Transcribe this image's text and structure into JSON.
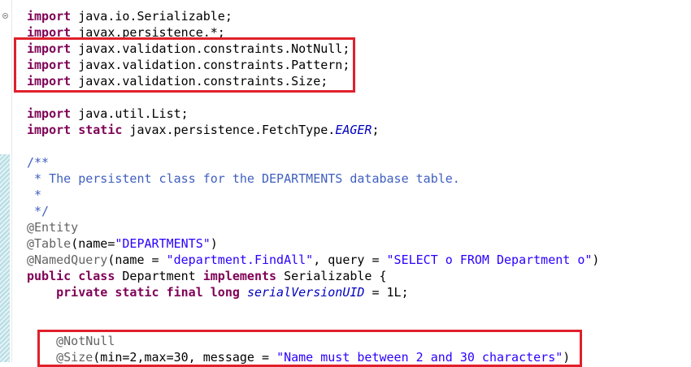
{
  "editor": {
    "language": "Java",
    "lines": [
      [
        {
          "t": "import",
          "c": "kw"
        },
        {
          "t": " java.io.Serializable;",
          "c": ""
        }
      ],
      [
        {
          "t": "import",
          "c": "kw"
        },
        {
          "t": " javax.persistence.*;",
          "c": ""
        }
      ],
      [
        {
          "t": "import",
          "c": "kw"
        },
        {
          "t": " javax.validation.constraints.NotNull;",
          "c": ""
        }
      ],
      [
        {
          "t": "import",
          "c": "kw"
        },
        {
          "t": " javax.validation.constraints.Pattern;",
          "c": ""
        }
      ],
      [
        {
          "t": "import",
          "c": "kw"
        },
        {
          "t": " javax.validation.constraints.Size;",
          "c": ""
        }
      ],
      [],
      [
        {
          "t": "import",
          "c": "kw"
        },
        {
          "t": " java.util.List;",
          "c": ""
        }
      ],
      [
        {
          "t": "import static",
          "c": "kw"
        },
        {
          "t": " javax.persistence.FetchType.",
          "c": ""
        },
        {
          "t": "EAGER",
          "c": "it"
        },
        {
          "t": ";",
          "c": ""
        }
      ],
      [],
      [
        {
          "t": "/**",
          "c": "cm"
        }
      ],
      [
        {
          "t": " * The persistent class for the DEPARTMENTS database table.",
          "c": "cm"
        }
      ],
      [
        {
          "t": " *",
          "c": "cm"
        }
      ],
      [
        {
          "t": " */",
          "c": "cm"
        }
      ],
      [
        {
          "t": "@Entity",
          "c": "ann"
        }
      ],
      [
        {
          "t": "@Table",
          "c": "ann"
        },
        {
          "t": "(name=",
          "c": ""
        },
        {
          "t": "\"DEPARTMENTS\"",
          "c": "str"
        },
        {
          "t": ")",
          "c": ""
        }
      ],
      [
        {
          "t": "@NamedQuery",
          "c": "ann"
        },
        {
          "t": "(name = ",
          "c": ""
        },
        {
          "t": "\"department.FindAll\"",
          "c": "str"
        },
        {
          "t": ", query = ",
          "c": ""
        },
        {
          "t": "\"SELECT o FROM Department o\"",
          "c": "str"
        },
        {
          "t": ")",
          "c": ""
        }
      ],
      [
        {
          "t": "public class",
          "c": "kw"
        },
        {
          "t": " Department ",
          "c": ""
        },
        {
          "t": "implements",
          "c": "kw"
        },
        {
          "t": " Serializable {",
          "c": ""
        }
      ],
      [
        {
          "t": "    ",
          "c": ""
        },
        {
          "t": "private static final long",
          "c": "kw"
        },
        {
          "t": " ",
          "c": ""
        },
        {
          "t": "serialVersionUID",
          "c": "it"
        },
        {
          "t": " = 1L;",
          "c": ""
        }
      ],
      [],
      [],
      [
        {
          "t": "    ",
          "c": ""
        },
        {
          "t": "@NotNull",
          "c": "ann"
        }
      ],
      [
        {
          "t": "    ",
          "c": ""
        },
        {
          "t": "@Size",
          "c": "ann"
        },
        {
          "t": "(min=2,max=30, message = ",
          "c": ""
        },
        {
          "t": "\"Name must between 2 and 30 characters\"",
          "c": "str"
        },
        {
          "t": ")",
          "c": ""
        }
      ]
    ]
  },
  "gutter": {
    "fold_icon_lines": [
      0,
      9
    ]
  },
  "highlights": [
    {
      "name": "imports-highlight-box",
      "color": "#e0202b",
      "first_line": 2,
      "last_line": 4
    },
    {
      "name": "annotations-highlight-box",
      "color": "#e0202b",
      "first_line": 20,
      "last_line": 21
    }
  ]
}
